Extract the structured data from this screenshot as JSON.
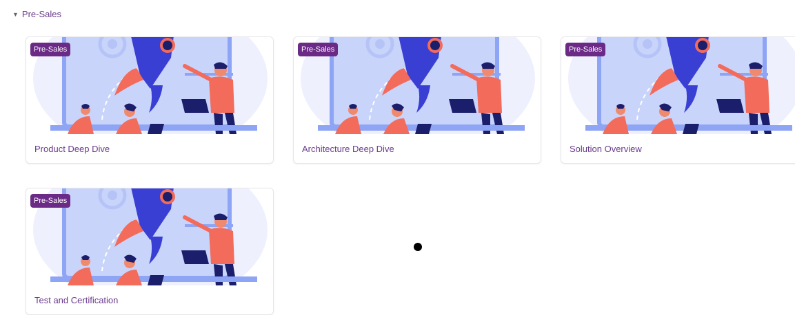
{
  "section": {
    "title": "Pre-Sales",
    "expanded_icon": "caret-down-icon"
  },
  "cards": [
    {
      "badge": "Pre-Sales",
      "title": "Product Deep Dive",
      "image_icon": "rocket-team-illustration"
    },
    {
      "badge": "Pre-Sales",
      "title": "Architecture Deep Dive",
      "image_icon": "rocket-team-illustration"
    },
    {
      "badge": "Pre-Sales",
      "title": "Solution Overview",
      "image_icon": "rocket-team-illustration"
    },
    {
      "badge": "Pre-Sales",
      "title": "Test and Certification",
      "image_icon": "rocket-team-illustration"
    }
  ],
  "colors": {
    "accent": "#6b3a8c",
    "badge_bg": "#6b2a86",
    "illustration_blue": "#3a3fd4",
    "illustration_coral": "#f26b5b"
  }
}
